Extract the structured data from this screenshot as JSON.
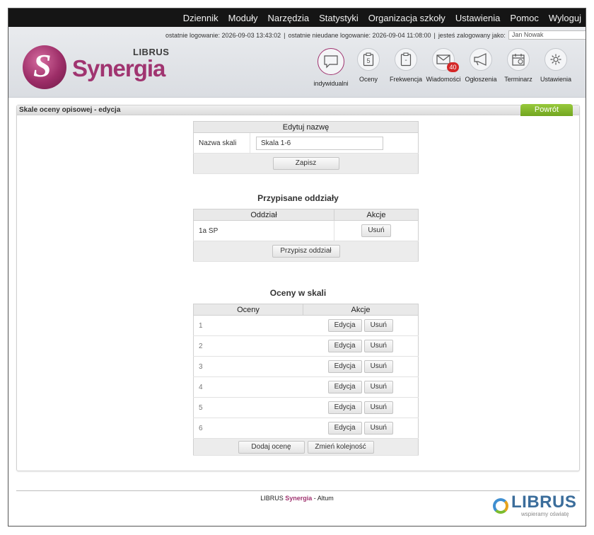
{
  "topmenu": [
    "Dziennik",
    "Moduły",
    "Narzędzia",
    "Statystyki",
    "Organizacja szkoły",
    "Ustawienia",
    "Pomoc",
    "Wyloguj"
  ],
  "login": {
    "last_login": "ostatnie logowanie: 2026-09-03 13:43:02",
    "last_failed": "ostatnie nieudane logowanie: 2026-09-04 11:08:00",
    "logged_as_label": "jesteś zalogowany jako:",
    "user": "Jan Nowak"
  },
  "logo": {
    "brand": "Synergia",
    "small": "LIBRUS"
  },
  "icons": [
    {
      "label": "indywidualni",
      "icon": "chat-bubble-icon"
    },
    {
      "label": "Oceny",
      "icon": "grade-clipboard-icon",
      "glyph": "5"
    },
    {
      "label": "Frekwencja",
      "icon": "attendance-clipboard-icon",
      "glyph": "-"
    },
    {
      "label": "Wiadomości",
      "icon": "envelope-icon",
      "badge": "40"
    },
    {
      "label": "Ogłoszenia",
      "icon": "megaphone-icon"
    },
    {
      "label": "Terminarz",
      "icon": "calendar-icon"
    },
    {
      "label": "Ustawienia",
      "icon": "gear-icon"
    }
  ],
  "page": {
    "title": "Skale oceny opisowej - edycja",
    "back": "Powrót"
  },
  "edit_name": {
    "header": "Edytuj nazwę",
    "label": "Nazwa skali",
    "value": "Skala 1-6",
    "save": "Zapisz"
  },
  "classes": {
    "title": "Przypisane oddziały",
    "headers": [
      "Oddział",
      "Akcje"
    ],
    "rows": [
      {
        "name": "1a SP",
        "action": "Usuń"
      }
    ],
    "add": "Przypisz oddział"
  },
  "grades": {
    "title": "Oceny w skali",
    "headers": [
      "Oceny",
      "Akcje"
    ],
    "rows": [
      "1",
      "2",
      "3",
      "4",
      "5",
      "6"
    ],
    "edit": "Edycja",
    "remove": "Usuń",
    "add": "Dodaj ocenę",
    "reorder": "Zmień kolejność"
  },
  "footer": {
    "prefix": "LIBRUS",
    "product": "Synergia",
    "suffix": "- Altum",
    "logo_word": "LIBRUS",
    "logo_tag": "wspieramy oświatę"
  }
}
